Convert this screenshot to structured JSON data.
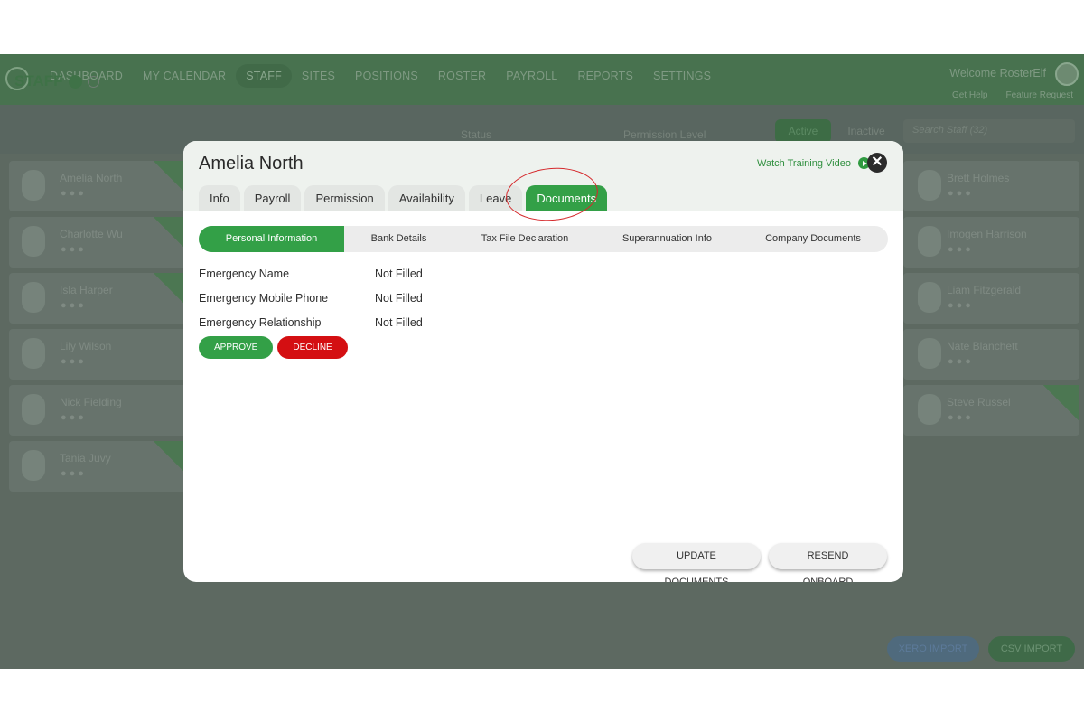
{
  "nav": {
    "items": [
      "DASHBOARD",
      "MY CALENDAR",
      "STAFF",
      "SITES",
      "POSITIONS",
      "ROSTER",
      "PAYROLL",
      "REPORTS",
      "SETTINGS"
    ],
    "active": "STAFF",
    "welcome": "Welcome RosterElf",
    "get_help": "Get Help",
    "feature_request": "Feature Request"
  },
  "staff_page": {
    "title": "STAFF",
    "status_filter": "Status",
    "permission_filter": "Permission Level",
    "active_label": "Active",
    "inactive_label": "Inactive",
    "search_placeholder": "Search Staff (32)",
    "left_staff": [
      "Amelia North",
      "Charlotte Wu",
      "Isla Harper",
      "Lily Wilson",
      "Nick Fielding",
      "Tania Juvy"
    ],
    "right_staff": [
      "Brett Holmes",
      "Imogen Harrison",
      "Liam Fitzgerald",
      "Nate Blanchett",
      "Steve Russel"
    ],
    "xero_import": "XERO IMPORT",
    "csv_import": "CSV IMPORT"
  },
  "modal": {
    "title": "Amelia North",
    "watch_video": "Watch Training Video",
    "close": "✕",
    "tabs": [
      "Info",
      "Payroll",
      "Permission",
      "Availability",
      "Leave",
      "Documents"
    ],
    "active_tab": "Documents",
    "subtabs": [
      "Personal Information",
      "Bank Details",
      "Tax File Declaration",
      "Superannuation Info",
      "Company Documents"
    ],
    "active_subtab": "Personal Information",
    "fields": [
      {
        "label": "Emergency Name",
        "value": "Not Filled"
      },
      {
        "label": "Emergency Mobile Phone",
        "value": "Not Filled"
      },
      {
        "label": "Emergency Relationship",
        "value": "Not Filled"
      }
    ],
    "approve": "APPROVE",
    "decline": "DECLINE",
    "update_documents": "UPDATE DOCUMENTS",
    "resend_onboard": "RESEND ONBOARD"
  }
}
